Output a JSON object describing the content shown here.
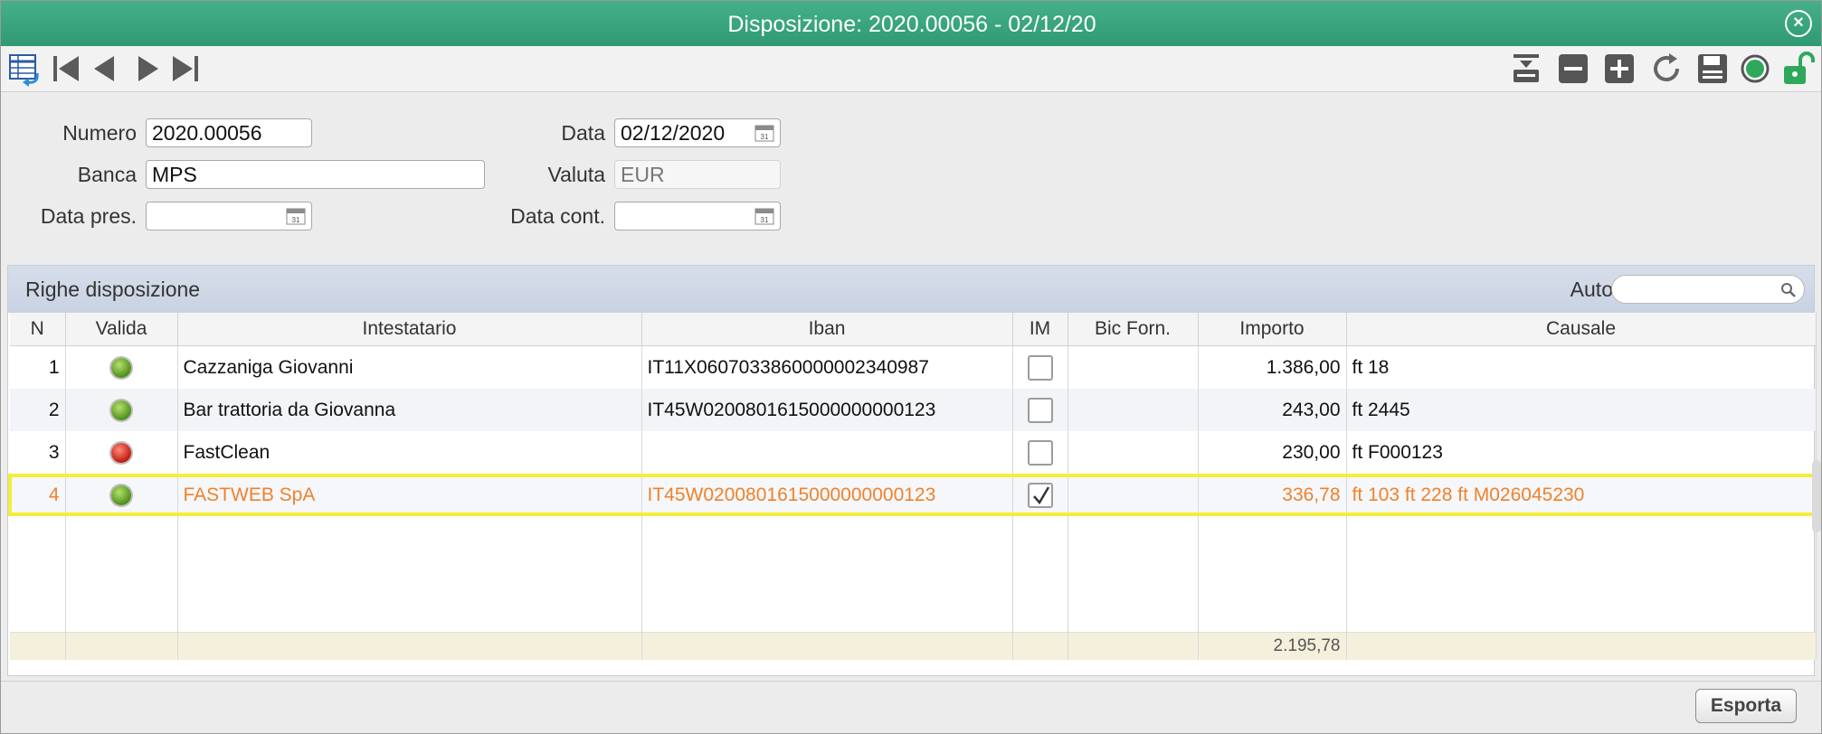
{
  "window": {
    "title": "Disposizione: 2020.00056 - 02/12/20"
  },
  "toolbar": {
    "left_icons": [
      "table-return-icon",
      "first-record-icon",
      "previous-record-icon",
      "next-record-icon",
      "last-record-icon"
    ],
    "right_icons": [
      "insert-row-icon",
      "remove-icon",
      "add-icon",
      "refresh-icon",
      "save-icon",
      "status-icon",
      "unlock-icon"
    ]
  },
  "form": {
    "numero": {
      "label": "Numero",
      "value": "2020.00056"
    },
    "data": {
      "label": "Data",
      "value": "02/12/2020"
    },
    "banca": {
      "label": "Banca",
      "value": "MPS"
    },
    "valuta": {
      "label": "Valuta",
      "value": "EUR"
    },
    "data_pres": {
      "label": "Data pres.",
      "value": ""
    },
    "data_cont": {
      "label": "Data cont.",
      "value": ""
    }
  },
  "grid": {
    "title": "Righe disposizione",
    "auto_label": "Auto",
    "search_value": "",
    "columns": [
      "N",
      "Valida",
      "Intestatario",
      "Iban",
      "IM",
      "Bic Forn.",
      "Importo",
      "Causale"
    ],
    "rows": [
      {
        "n": "1",
        "valida": "green",
        "intestatario": "Cazzaniga Giovanni",
        "iban": "IT11X0607033860000002340987",
        "im": false,
        "bic": "",
        "importo": "1.386,00",
        "causale": "ft 18"
      },
      {
        "n": "2",
        "valida": "green",
        "intestatario": "Bar trattoria da Giovanna",
        "iban": "IT45W0200801615000000000123",
        "im": false,
        "bic": "",
        "importo": "243,00",
        "causale": "ft 2445"
      },
      {
        "n": "3",
        "valida": "red",
        "intestatario": "FastClean",
        "iban": "",
        "im": false,
        "bic": "",
        "importo": "230,00",
        "causale": "ft F000123"
      },
      {
        "n": "4",
        "valida": "green",
        "intestatario": "FASTWEB SpA",
        "iban": "IT45W0200801615000000000123",
        "im": true,
        "bic": "",
        "importo": "336,78",
        "causale": "ft 103 ft 228 ft M026045230"
      }
    ],
    "total": "2.195,78"
  },
  "footer": {
    "export_label": "Esporta"
  },
  "colors": {
    "title_bar": "#3aa57e",
    "highlight": "#f4ee3a",
    "selected_text": "#f0812a",
    "led_green": "#4e8f1c",
    "led_red": "#c01a10"
  }
}
